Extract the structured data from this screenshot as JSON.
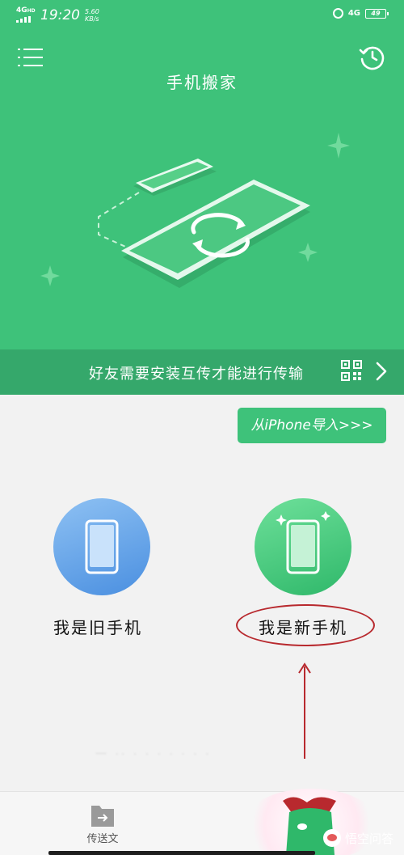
{
  "status_bar": {
    "network": "4G",
    "network_hd": "HD",
    "time": "19:20",
    "speed_value": "5.60",
    "speed_unit": "KB/s",
    "right_network": "4G",
    "icons": [
      "signal-icon",
      "alarm-icon",
      "battery-icon"
    ]
  },
  "header": {
    "title": "手机搬家",
    "menu_icon": "menu-icon",
    "history_icon": "history-icon"
  },
  "banner": {
    "text": "好友需要安装互传才能进行传输",
    "qr_icon": "qr-code-icon",
    "arrow_icon": "chevron-right-icon"
  },
  "import_button": {
    "label": "从iPhone导入>>>"
  },
  "roles": {
    "old_phone": {
      "label": "我是旧手机",
      "icon": "phone-icon"
    },
    "new_phone": {
      "label": "我是新手机",
      "icon": "phone-sparkle-icon"
    }
  },
  "bottom_tab": {
    "label": "传送文",
    "icon": "folder-send-icon"
  },
  "watermark": {
    "text": "悟空问答"
  },
  "colors": {
    "brand_green": "#3ec27a",
    "banner_green": "#35a86b",
    "old_phone_blue": "#4a8fe0",
    "annotation_red": "#b8292e"
  }
}
